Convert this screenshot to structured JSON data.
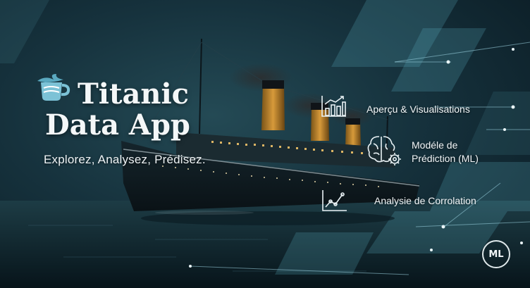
{
  "hero": {
    "title_line1": "Titanic",
    "title_line2": "Data App",
    "tagline": "Explorez, Analysez, Prédisez."
  },
  "features": [
    {
      "icon": "bar-chart-icon",
      "label": "Aperçu & Visualisations"
    },
    {
      "icon": "brain-gear-icon",
      "label_line1": "Modéle de",
      "label_line2": "Prédiction (ML)"
    },
    {
      "icon": "line-chart-icon",
      "label": "Analysie de Corrolation"
    }
  ],
  "badge": {
    "label": "ML"
  },
  "colors": {
    "background": "#16323d",
    "accent_light": "#79c6dc",
    "text": "#f2f6f8"
  }
}
